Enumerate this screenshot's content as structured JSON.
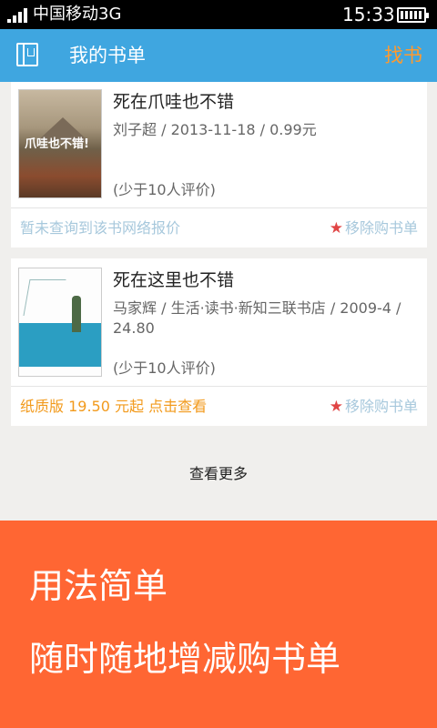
{
  "status_bar": {
    "carrier": "中国移动3G",
    "time": "15:33"
  },
  "app_bar": {
    "title": "我的书单",
    "find_label": "找书",
    "icon": "book-icon"
  },
  "books": [
    {
      "title": "死在爪哇也不错",
      "meta": "刘子超 / 2013-11-18 / 0.99元",
      "rating": "(少于10人评价)",
      "price_note": "暂未查询到该书网络报价",
      "remove_label": "移除购书单",
      "cover_text": "爪哇也不错!"
    },
    {
      "title": "死在这里也不错",
      "meta": "马家辉 / 生活·读书·新知三联书店 / 2009-4 / 24.80",
      "rating": "(少于10人评价)",
      "price_note": "纸质版 19.50 元起 点击查看",
      "remove_label": "移除购书单"
    }
  ],
  "more_label": "查看更多",
  "banner": {
    "line1": "用法简单",
    "line2": "随时随地增减购书单"
  },
  "colors": {
    "app_bar": "#3fa6e0",
    "find_button": "#ff9a2e",
    "banner": "#ff6633",
    "price_orange": "#f29a1c",
    "muted_link": "#a7c8dc",
    "star": "#e04545"
  }
}
